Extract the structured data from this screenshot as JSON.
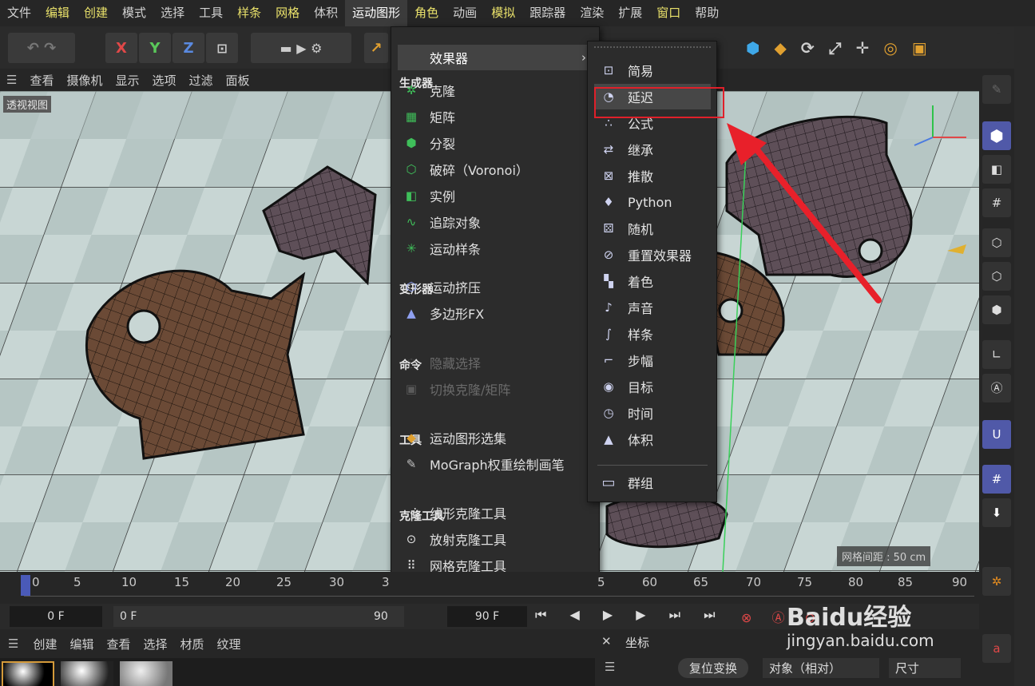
{
  "menubar": {
    "items": [
      {
        "label": "文件",
        "style": "normal"
      },
      {
        "label": "编辑",
        "style": "yellow"
      },
      {
        "label": "创建",
        "style": "yellow"
      },
      {
        "label": "模式",
        "style": "normal"
      },
      {
        "label": "选择",
        "style": "normal"
      },
      {
        "label": "工具",
        "style": "normal"
      },
      {
        "label": "样条",
        "style": "yellow"
      },
      {
        "label": "网格",
        "style": "yellow"
      },
      {
        "label": "体积",
        "style": "normal"
      },
      {
        "label": "运动图形",
        "style": "active"
      },
      {
        "label": "角色",
        "style": "yellow"
      },
      {
        "label": "动画",
        "style": "normal"
      },
      {
        "label": "模拟",
        "style": "yellow"
      },
      {
        "label": "跟踪器",
        "style": "normal"
      },
      {
        "label": "渲染",
        "style": "normal"
      },
      {
        "label": "扩展",
        "style": "normal"
      },
      {
        "label": "窗口",
        "style": "yellow"
      },
      {
        "label": "帮助",
        "style": "normal"
      }
    ]
  },
  "toolbar": {
    "x": "X",
    "y": "Y",
    "z": "Z"
  },
  "viewport_menu": [
    "查看",
    "摄像机",
    "显示",
    "选项",
    "过滤",
    "面板"
  ],
  "viewport": {
    "label": "透视视图",
    "grid_spacing": "网格间距 : 50 cm"
  },
  "mograph_menu": {
    "effector": "效果器",
    "sections": {
      "generators": "生成器",
      "deformers": "变形器",
      "commands": "命令",
      "tools": "工具",
      "clone_tools": "克隆工具"
    },
    "generators": [
      "克隆",
      "矩阵",
      "分裂",
      "破碎（Voronoi）",
      "实例",
      "追踪对象",
      "运动样条"
    ],
    "deformers": [
      "运动挤压",
      "多边形FX"
    ],
    "commands": [
      "隐藏选择",
      "切换克隆/矩阵"
    ],
    "tools": [
      "运动图形选集",
      "MoGraph权重绘制画笔"
    ],
    "clone_tools": [
      "线形克隆工具",
      "放射克隆工具",
      "网格克隆工具"
    ]
  },
  "effector_menu": {
    "items": [
      "简易",
      "延迟",
      "公式",
      "继承",
      "推散",
      "Python",
      "随机",
      "重置效果器",
      "着色",
      "声音",
      "样条",
      "步幅",
      "目标",
      "时间",
      "体积"
    ],
    "highlighted": "延迟",
    "group": "群组"
  },
  "timeline": {
    "ticks": [
      "0",
      "5",
      "10",
      "15",
      "20",
      "25",
      "30",
      "3",
      "5",
      "60",
      "65",
      "70",
      "75",
      "80",
      "85",
      "90"
    ],
    "current_frame": "0 F",
    "start_frame": "0 F",
    "end_frame": "90 F",
    "end_frame2": "90 F"
  },
  "material_bar": [
    "创建",
    "编辑",
    "查看",
    "选择",
    "材质",
    "纹理"
  ],
  "coord_panel": {
    "title": "坐标",
    "reset": "复位变换",
    "mode": "对象（相对）",
    "size": "尺寸"
  },
  "watermark": {
    "text": "Baidu经验",
    "url": "jingyan.baidu.com"
  },
  "colors": {
    "accent_red": "#e0202a",
    "menu_active": "#3b3b3b",
    "mograph_green": "#3fbf5a",
    "effector_blue": "#7a8ae0"
  }
}
